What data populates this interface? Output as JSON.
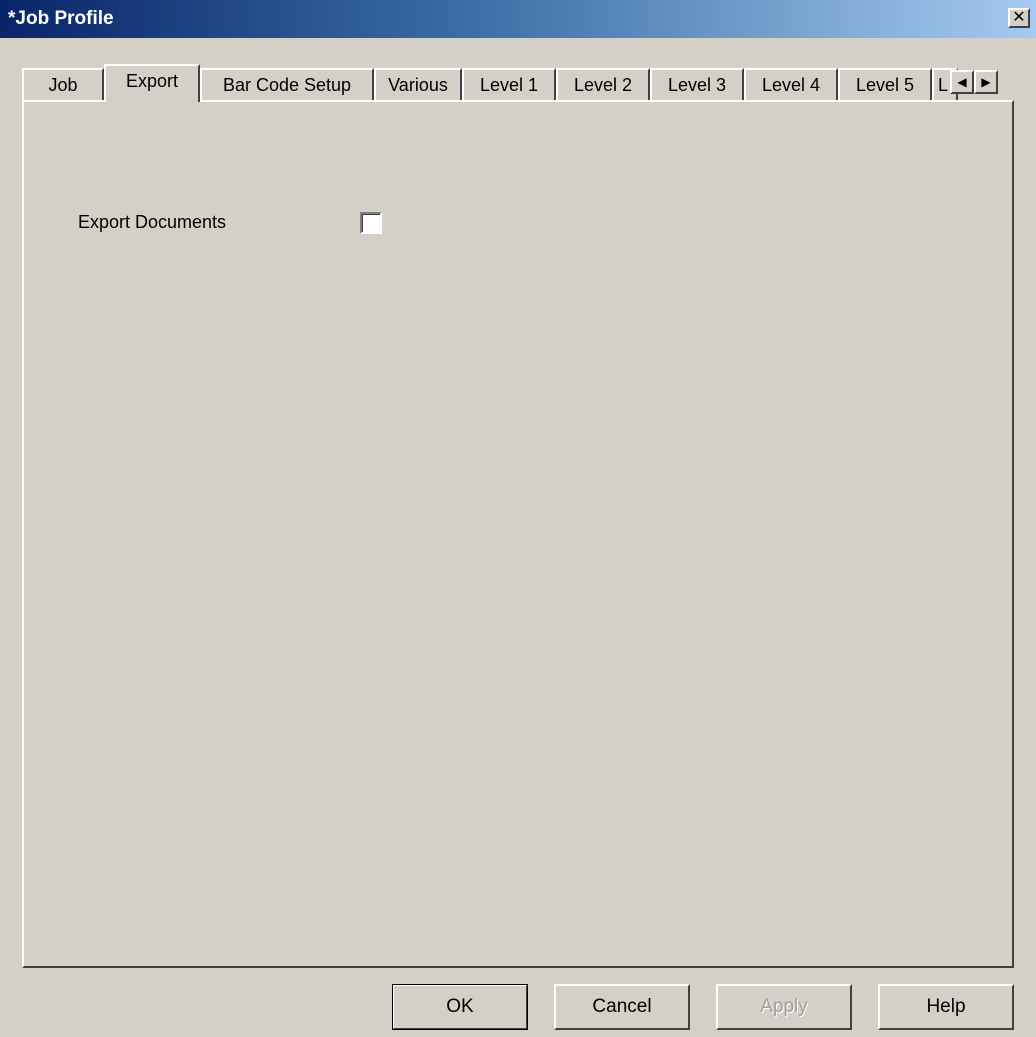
{
  "window": {
    "title": "*Job Profile",
    "close_glyph": "✕"
  },
  "tabs": [
    {
      "label": "Job",
      "active": false
    },
    {
      "label": "Export",
      "active": true
    },
    {
      "label": "Bar Code Setup",
      "active": false
    },
    {
      "label": "Various",
      "active": false
    },
    {
      "label": "Level 1",
      "active": false
    },
    {
      "label": "Level 2",
      "active": false
    },
    {
      "label": "Level 3",
      "active": false
    },
    {
      "label": "Level 4",
      "active": false
    },
    {
      "label": "Level 5",
      "active": false
    },
    {
      "label": "L",
      "active": false
    }
  ],
  "tab_scroll": {
    "left_icon": "arrow-left-icon",
    "right_icon": "arrow-right-icon",
    "left_glyph": "◀",
    "right_glyph": "▶"
  },
  "export": {
    "export_documents_label": "Export Documents",
    "export_documents_checked": false
  },
  "buttons": {
    "ok": "OK",
    "cancel": "Cancel",
    "apply": "Apply",
    "help": "Help"
  },
  "colors": {
    "title_start": "#0a246a",
    "title_end": "#a6caf0",
    "face": "#d4d0c8"
  }
}
